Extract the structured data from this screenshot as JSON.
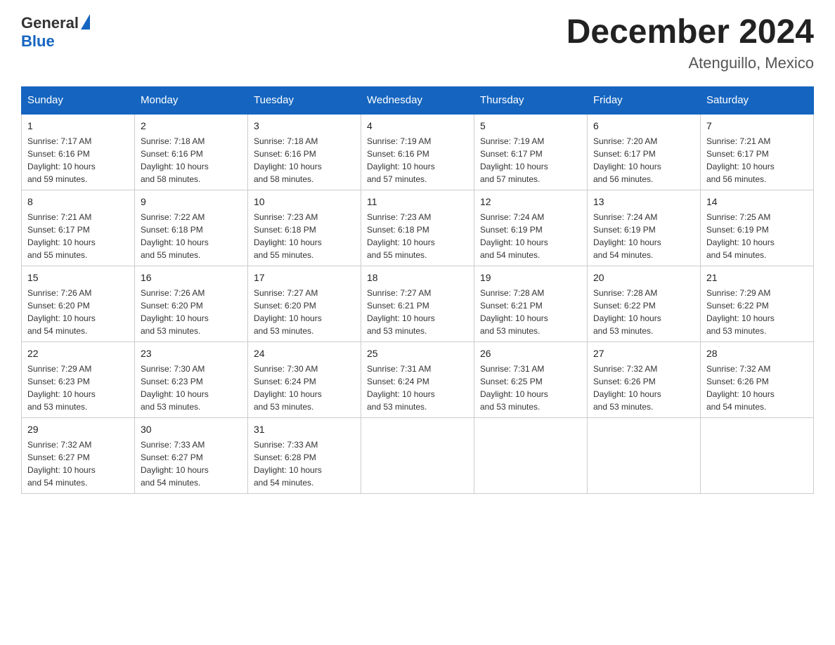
{
  "header": {
    "logo_general": "General",
    "logo_blue": "Blue",
    "month_title": "December 2024",
    "location": "Atenguillo, Mexico"
  },
  "days_of_week": [
    "Sunday",
    "Monday",
    "Tuesday",
    "Wednesday",
    "Thursday",
    "Friday",
    "Saturday"
  ],
  "weeks": [
    [
      {
        "day": "1",
        "sunrise": "7:17 AM",
        "sunset": "6:16 PM",
        "daylight": "10 hours and 59 minutes."
      },
      {
        "day": "2",
        "sunrise": "7:18 AM",
        "sunset": "6:16 PM",
        "daylight": "10 hours and 58 minutes."
      },
      {
        "day": "3",
        "sunrise": "7:18 AM",
        "sunset": "6:16 PM",
        "daylight": "10 hours and 58 minutes."
      },
      {
        "day": "4",
        "sunrise": "7:19 AM",
        "sunset": "6:16 PM",
        "daylight": "10 hours and 57 minutes."
      },
      {
        "day": "5",
        "sunrise": "7:19 AM",
        "sunset": "6:17 PM",
        "daylight": "10 hours and 57 minutes."
      },
      {
        "day": "6",
        "sunrise": "7:20 AM",
        "sunset": "6:17 PM",
        "daylight": "10 hours and 56 minutes."
      },
      {
        "day": "7",
        "sunrise": "7:21 AM",
        "sunset": "6:17 PM",
        "daylight": "10 hours and 56 minutes."
      }
    ],
    [
      {
        "day": "8",
        "sunrise": "7:21 AM",
        "sunset": "6:17 PM",
        "daylight": "10 hours and 55 minutes."
      },
      {
        "day": "9",
        "sunrise": "7:22 AM",
        "sunset": "6:18 PM",
        "daylight": "10 hours and 55 minutes."
      },
      {
        "day": "10",
        "sunrise": "7:23 AM",
        "sunset": "6:18 PM",
        "daylight": "10 hours and 55 minutes."
      },
      {
        "day": "11",
        "sunrise": "7:23 AM",
        "sunset": "6:18 PM",
        "daylight": "10 hours and 55 minutes."
      },
      {
        "day": "12",
        "sunrise": "7:24 AM",
        "sunset": "6:19 PM",
        "daylight": "10 hours and 54 minutes."
      },
      {
        "day": "13",
        "sunrise": "7:24 AM",
        "sunset": "6:19 PM",
        "daylight": "10 hours and 54 minutes."
      },
      {
        "day": "14",
        "sunrise": "7:25 AM",
        "sunset": "6:19 PM",
        "daylight": "10 hours and 54 minutes."
      }
    ],
    [
      {
        "day": "15",
        "sunrise": "7:26 AM",
        "sunset": "6:20 PM",
        "daylight": "10 hours and 54 minutes."
      },
      {
        "day": "16",
        "sunrise": "7:26 AM",
        "sunset": "6:20 PM",
        "daylight": "10 hours and 53 minutes."
      },
      {
        "day": "17",
        "sunrise": "7:27 AM",
        "sunset": "6:20 PM",
        "daylight": "10 hours and 53 minutes."
      },
      {
        "day": "18",
        "sunrise": "7:27 AM",
        "sunset": "6:21 PM",
        "daylight": "10 hours and 53 minutes."
      },
      {
        "day": "19",
        "sunrise": "7:28 AM",
        "sunset": "6:21 PM",
        "daylight": "10 hours and 53 minutes."
      },
      {
        "day": "20",
        "sunrise": "7:28 AM",
        "sunset": "6:22 PM",
        "daylight": "10 hours and 53 minutes."
      },
      {
        "day": "21",
        "sunrise": "7:29 AM",
        "sunset": "6:22 PM",
        "daylight": "10 hours and 53 minutes."
      }
    ],
    [
      {
        "day": "22",
        "sunrise": "7:29 AM",
        "sunset": "6:23 PM",
        "daylight": "10 hours and 53 minutes."
      },
      {
        "day": "23",
        "sunrise": "7:30 AM",
        "sunset": "6:23 PM",
        "daylight": "10 hours and 53 minutes."
      },
      {
        "day": "24",
        "sunrise": "7:30 AM",
        "sunset": "6:24 PM",
        "daylight": "10 hours and 53 minutes."
      },
      {
        "day": "25",
        "sunrise": "7:31 AM",
        "sunset": "6:24 PM",
        "daylight": "10 hours and 53 minutes."
      },
      {
        "day": "26",
        "sunrise": "7:31 AM",
        "sunset": "6:25 PM",
        "daylight": "10 hours and 53 minutes."
      },
      {
        "day": "27",
        "sunrise": "7:32 AM",
        "sunset": "6:26 PM",
        "daylight": "10 hours and 53 minutes."
      },
      {
        "day": "28",
        "sunrise": "7:32 AM",
        "sunset": "6:26 PM",
        "daylight": "10 hours and 54 minutes."
      }
    ],
    [
      {
        "day": "29",
        "sunrise": "7:32 AM",
        "sunset": "6:27 PM",
        "daylight": "10 hours and 54 minutes."
      },
      {
        "day": "30",
        "sunrise": "7:33 AM",
        "sunset": "6:27 PM",
        "daylight": "10 hours and 54 minutes."
      },
      {
        "day": "31",
        "sunrise": "7:33 AM",
        "sunset": "6:28 PM",
        "daylight": "10 hours and 54 minutes."
      },
      null,
      null,
      null,
      null
    ]
  ],
  "labels": {
    "sunrise": "Sunrise:",
    "sunset": "Sunset:",
    "daylight": "Daylight:"
  }
}
